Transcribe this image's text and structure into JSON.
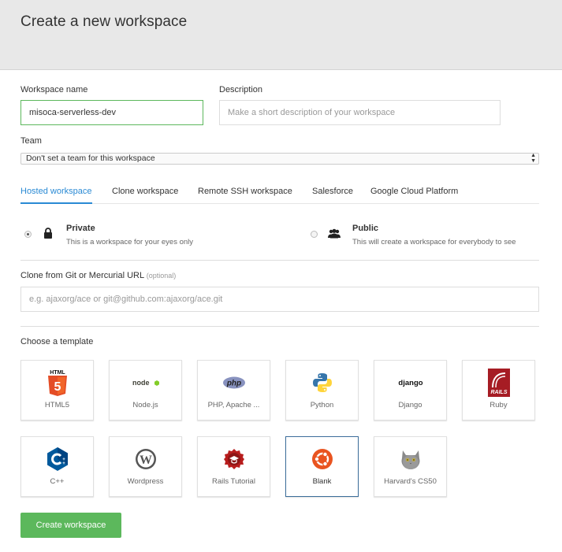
{
  "header": {
    "title": "Create a new workspace"
  },
  "form": {
    "workspace_name_label": "Workspace name",
    "workspace_name_value": "misoca-serverless-dev",
    "description_label": "Description",
    "description_placeholder": "Make a short description of your workspace",
    "team_label": "Team",
    "team_selected": "Don't set a team for this workspace",
    "clone_label": "Clone from Git or Mercurial URL",
    "clone_optional": "(optional)",
    "clone_placeholder": "e.g. ajaxorg/ace or git@github.com:ajaxorg/ace.git",
    "template_label": "Choose a template"
  },
  "tabs": [
    {
      "label": "Hosted workspace",
      "active": true
    },
    {
      "label": "Clone workspace",
      "active": false
    },
    {
      "label": "Remote SSH workspace",
      "active": false
    },
    {
      "label": "Salesforce",
      "active": false
    },
    {
      "label": "Google Cloud Platform",
      "active": false
    }
  ],
  "visibility": {
    "private": {
      "title": "Private",
      "desc": "This is a workspace for your eyes only",
      "checked": true,
      "icon": "lock-icon"
    },
    "public": {
      "title": "Public",
      "desc": "This will create a workspace for everybody to see",
      "checked": false,
      "icon": "users-icon"
    }
  },
  "templates": [
    {
      "label": "HTML5",
      "icon": "html5-icon",
      "badge": "HTML",
      "selected": false
    },
    {
      "label": "Node.js",
      "icon": "nodejs-icon",
      "badge": "node",
      "selected": false
    },
    {
      "label": "PHP, Apache ...",
      "icon": "php-icon",
      "badge": "php",
      "selected": false
    },
    {
      "label": "Python",
      "icon": "python-icon",
      "selected": false
    },
    {
      "label": "Django",
      "icon": "django-icon",
      "badge": "django",
      "selected": false
    },
    {
      "label": "Ruby",
      "icon": "ruby-icon",
      "badge": "RAILS",
      "selected": false
    },
    {
      "label": "C++",
      "icon": "cpp-icon",
      "selected": false
    },
    {
      "label": "Wordpress",
      "icon": "wordpress-icon",
      "selected": false
    },
    {
      "label": "Rails Tutorial",
      "icon": "rails-tutorial-icon",
      "selected": false
    },
    {
      "label": "Blank",
      "icon": "ubuntu-icon",
      "selected": true
    },
    {
      "label": "Harvard's CS50",
      "icon": "cs50-cat-icon",
      "selected": false
    }
  ],
  "actions": {
    "create_label": "Create workspace"
  },
  "colors": {
    "primary": "#5cb85c",
    "tab_active": "#2a8ad4",
    "selected_border": "#3b6d9a"
  }
}
